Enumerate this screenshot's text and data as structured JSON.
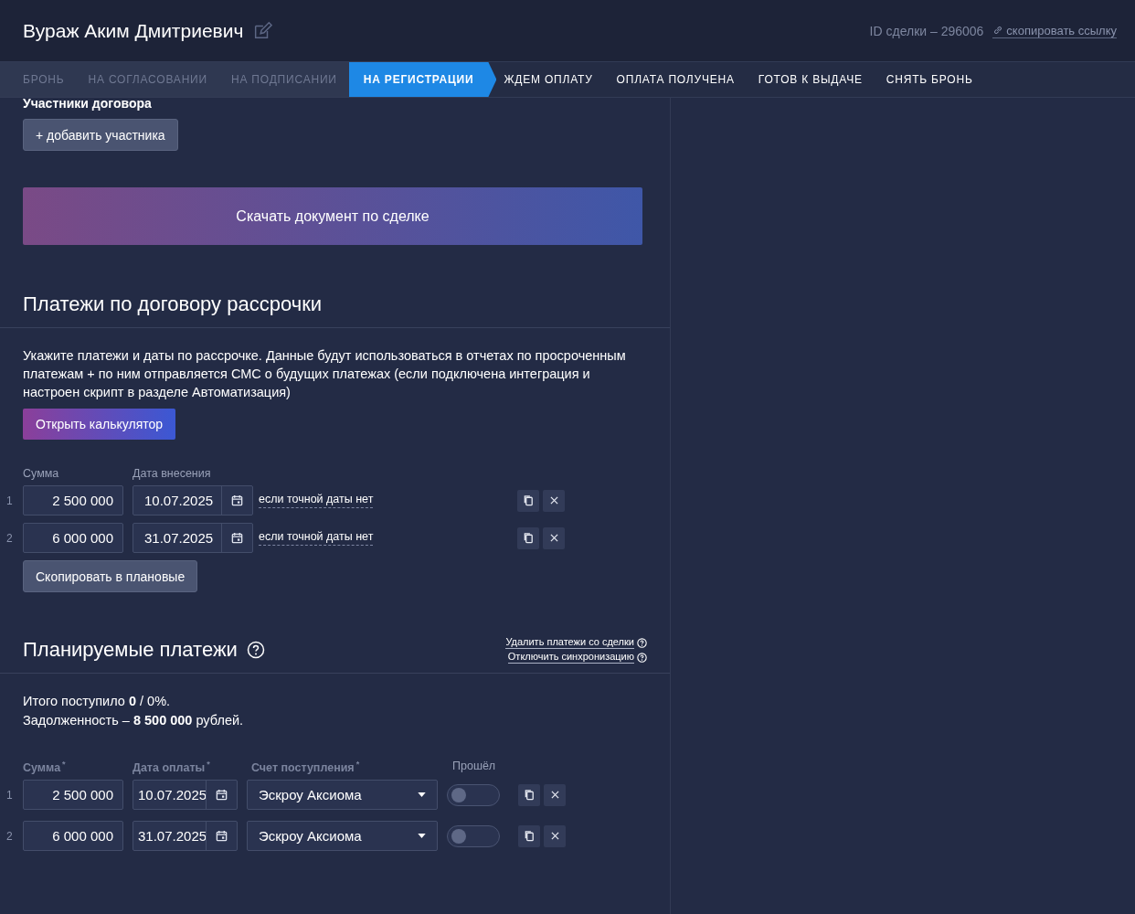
{
  "header": {
    "title": "Вураж Аким Дмитриевич",
    "deal_id": "ID сделки – 296006",
    "copy_link": "скопировать ссылку"
  },
  "tabs": [
    {
      "label": "БРОНЬ",
      "selected": false,
      "done": true
    },
    {
      "label": "НА СОГЛАСОВАНИИ",
      "selected": false,
      "done": true
    },
    {
      "label": "НА ПОДПИСАНИИ",
      "selected": false,
      "done": true
    },
    {
      "label": "НА РЕГИСТРАЦИИ",
      "selected": true,
      "done": false
    },
    {
      "label": "ЖДЕМ ОПЛАТУ",
      "selected": false,
      "done": false
    },
    {
      "label": "ОПЛАТА ПОЛУЧЕНА",
      "selected": false,
      "done": false
    },
    {
      "label": "ГОТОВ К ВЫДАЧЕ",
      "selected": false,
      "done": false
    },
    {
      "label": "СНЯТЬ БРОНЬ",
      "selected": false,
      "done": false
    }
  ],
  "participants": {
    "heading": "Участники договора",
    "add_button": "+ добавить участника"
  },
  "download_button": "Скачать документ по сделке",
  "installments": {
    "title": "Платежи по договору рассрочки",
    "description": "Укажите платежи и даты по рассрочке. Данные будут использоваться в отчетах по просроченным платежам + по ним отправляется СМС о будущих платежах (если подключена интеграция и настроен скрипт в разделе Автоматизация)",
    "calculator_button": "Открыть калькулятор",
    "columns": [
      "Сумма",
      "Дата внесения"
    ],
    "rows": [
      {
        "index": "1",
        "amount": "2 500 000",
        "date": "10.07.2025",
        "no_date_link": "если точной даты нет"
      },
      {
        "index": "2",
        "amount": "6 000 000",
        "date": "31.07.2025",
        "no_date_link": "если точной даты нет"
      }
    ],
    "copy_button": "Скопировать в плановые"
  },
  "planned": {
    "title": "Планируемые платежи",
    "links": [
      "Удалить платежи со сделки",
      "Отключить синхронизацию"
    ],
    "total_line": "Итого поступило **0** / 0%.",
    "debt_line": "Задолженность – **8 500 000** рублей.",
    "columns": [
      {
        "label": "Сумма",
        "mark": "*"
      },
      {
        "label": "Дата оплаты",
        "mark": "*"
      },
      {
        "label": "Счет поступления",
        "mark": "*"
      },
      {
        "label": "Прошёл"
      }
    ],
    "rows": [
      {
        "index": "1",
        "amount": "2 500 000",
        "date": "10.07.2025",
        "account": "Эскроу Аксиома",
        "on": false
      },
      {
        "index": "2",
        "amount": "6 000 000",
        "date": "31.07.2025",
        "account": "Эскроу Аксиома",
        "on": false
      }
    ]
  }
}
